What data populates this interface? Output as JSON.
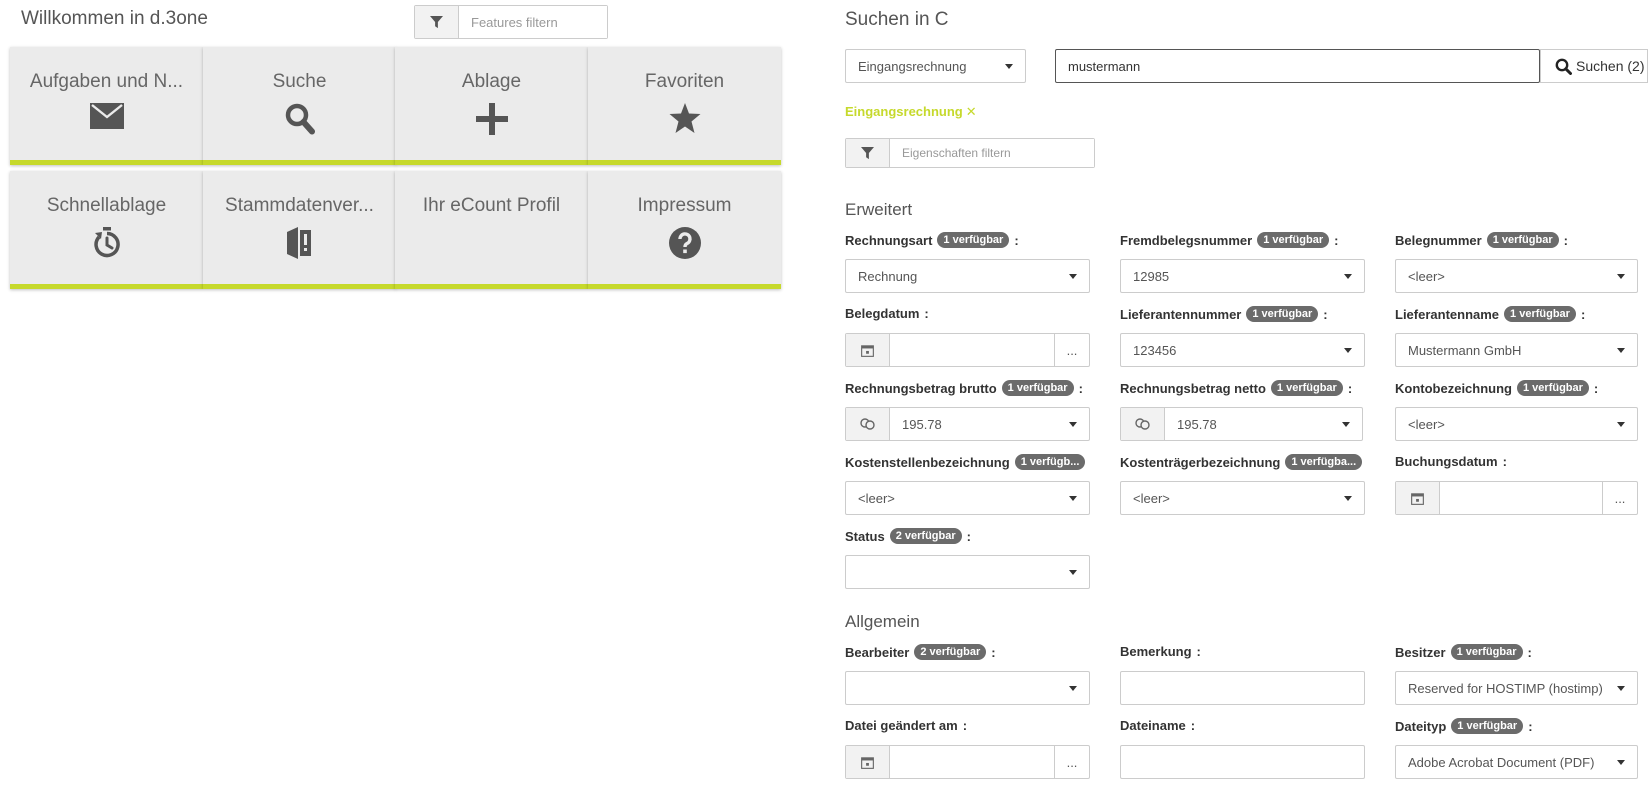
{
  "left": {
    "title": "Willkommen in d.3one",
    "filter_placeholder": "Features filtern",
    "tiles": [
      {
        "label": "Aufgaben und N...",
        "icon": "envelope-icon"
      },
      {
        "label": "Suche",
        "icon": "search-icon"
      },
      {
        "label": "Ablage",
        "icon": "plus-icon"
      },
      {
        "label": "Favoriten",
        "icon": "star-icon"
      },
      {
        "label": "Schnellablage",
        "icon": "stopwatch-icon"
      },
      {
        "label": "Stammdatenver...",
        "icon": "book-alert-icon"
      },
      {
        "label": "Ihr eCount Profil",
        "icon": ""
      },
      {
        "label": "Impressum",
        "icon": "question-icon"
      }
    ]
  },
  "right": {
    "title": "Suchen in C",
    "category": "Eingangsrechnung",
    "search_value": "mustermann",
    "search_button": "Suchen (2)",
    "chip": "Eingangsrechnung",
    "chip_close": "✕",
    "prop_filter_placeholder": "Eigenschaften filtern",
    "sections": {
      "erweitert": "Erweitert",
      "allgemein": "Allgemein"
    },
    "fields": {
      "rechnungsart": {
        "label": "Rechnungsart",
        "badge": "1 verfügbar",
        "value": "Rechnung"
      },
      "fremdbelegsnummer": {
        "label": "Fremdbelegsnummer",
        "badge": "1 verfügbar",
        "value": "12985"
      },
      "belegnummer": {
        "label": "Belegnummer",
        "badge": "1 verfügbar",
        "value": "<leer>"
      },
      "belegdatum": {
        "label": "Belegdatum",
        "value": "",
        "dots": "..."
      },
      "lieferantennummer": {
        "label": "Lieferantennummer",
        "badge": "1 verfügbar",
        "value": "123456"
      },
      "lieferantenname": {
        "label": "Lieferantenname",
        "badge": "1 verfügbar",
        "value": "Mustermann GmbH"
      },
      "brutto": {
        "label": "Rechnungsbetrag brutto",
        "badge": "1 verfügbar",
        "value": "195.78"
      },
      "netto": {
        "label": "Rechnungsbetrag netto",
        "badge": "1 verfügbar",
        "value": "195.78"
      },
      "kontobezeichnung": {
        "label": "Kontobezeichnung",
        "badge": "1 verfügbar",
        "value": "<leer>"
      },
      "kostenstelle": {
        "label": "Kostenstellenbezeichnung",
        "badge": "1 verfügb...",
        "value": "<leer>"
      },
      "kostentraeger": {
        "label": "Kostenträgerbezeichnung",
        "badge": "1 verfügba...",
        "value": "<leer>"
      },
      "buchungsdatum": {
        "label": "Buchungsdatum",
        "value": "",
        "dots": "..."
      },
      "status": {
        "label": "Status",
        "badge": "2 verfügbar",
        "value": ""
      },
      "bearbeiter": {
        "label": "Bearbeiter",
        "badge": "2 verfügbar",
        "value": ""
      },
      "bemerkung": {
        "label": "Bemerkung",
        "value": ""
      },
      "besitzer": {
        "label": "Besitzer",
        "badge": "1 verfügbar",
        "value": "Reserved for HOSTIMP (hostimp)"
      },
      "datei_geaendert": {
        "label": "Datei geändert am",
        "value": "",
        "dots": "..."
      },
      "dateiname": {
        "label": "Dateiname",
        "value": ""
      },
      "dateityp": {
        "label": "Dateityp",
        "badge": "1 verfügbar",
        "value": "Adobe Acrobat Document (PDF)"
      }
    }
  },
  "colors": {
    "accent": "#c6d92c",
    "badge": "#6b6b6b",
    "tile": "#ebebeb",
    "icon": "#555555"
  }
}
